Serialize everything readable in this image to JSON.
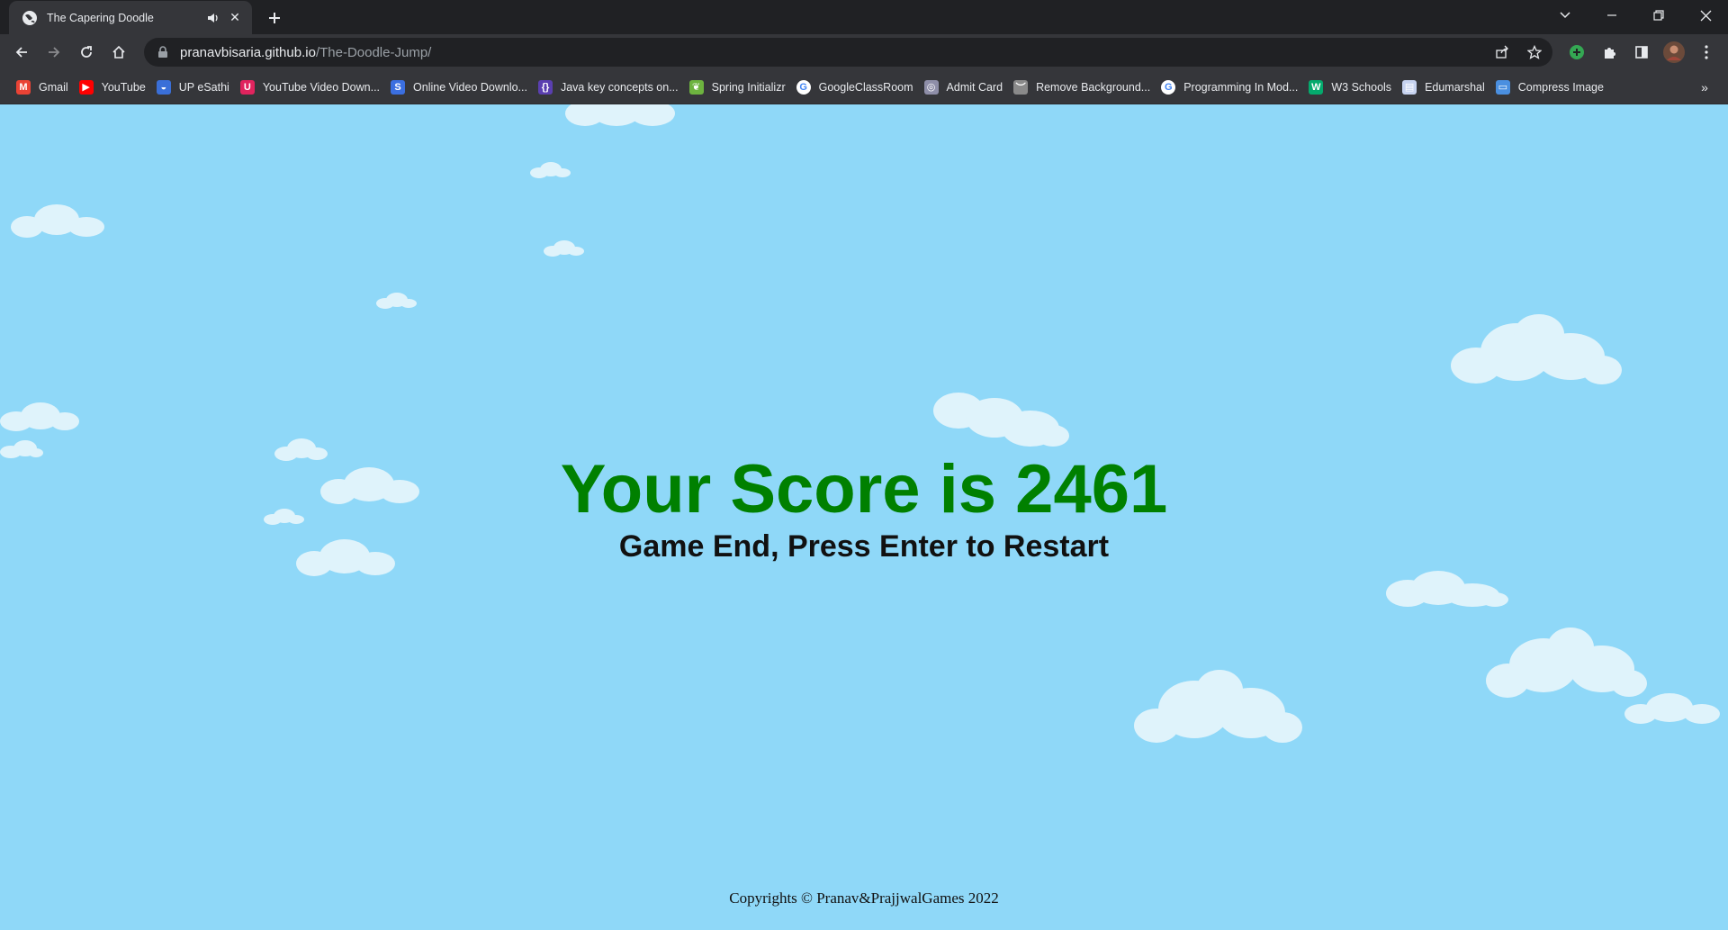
{
  "browser": {
    "tab": {
      "title": "The Capering Doodle",
      "audio_icon": "speaker-icon",
      "close_label": "✕"
    },
    "new_tab_label": "+",
    "address_bar": {
      "domain": "pranavbisaria.github.io",
      "path": "/The-Doodle-Jump/"
    },
    "bookmarks": [
      {
        "label": "Gmail",
        "icon": "gmail-icon",
        "color": "#ea4335",
        "glyph": "M"
      },
      {
        "label": "YouTube",
        "icon": "youtube-icon",
        "color": "#ff0000",
        "glyph": "▶"
      },
      {
        "label": "UP eSathi",
        "icon": "upesathi-icon",
        "color": "#3a6fd8",
        "glyph": "◒"
      },
      {
        "label": "YouTube Video Down...",
        "icon": "download-icon",
        "color": "#e0245e",
        "glyph": "U"
      },
      {
        "label": "Online Video Downlo...",
        "icon": "s-icon",
        "color": "#3b6fe0",
        "glyph": "S"
      },
      {
        "label": "Java key concepts on...",
        "icon": "java-icon",
        "color": "#5a3fb0",
        "glyph": "{}"
      },
      {
        "label": "Spring Initializr",
        "icon": "spring-icon",
        "color": "#6db33f",
        "glyph": "❦"
      },
      {
        "label": "GoogleClassRoom",
        "icon": "google-icon",
        "color": "#ffffff",
        "glyph": "G"
      },
      {
        "label": "Admit Card",
        "icon": "admit-card-icon",
        "color": "#8e8ea8",
        "glyph": "◎"
      },
      {
        "label": "Remove Background...",
        "icon": "remove-bg-icon",
        "color": "#8a8a8a",
        "glyph": "︶"
      },
      {
        "label": "Programming In Mod...",
        "icon": "google-icon",
        "color": "#ffffff",
        "glyph": "G"
      },
      {
        "label": "W3 Schools",
        "icon": "w3schools-icon",
        "color": "#04aa6d",
        "glyph": "W"
      },
      {
        "label": "Edumarshal",
        "icon": "page-icon",
        "color": "#c7d3f0",
        "glyph": "▤"
      },
      {
        "label": "Compress Image",
        "icon": "image-icon",
        "color": "#4a8fe0",
        "glyph": "▭"
      }
    ],
    "bookmarks_more": "»"
  },
  "game": {
    "score_text": "Your Score is 2461",
    "restart_text": "Game End, Press Enter to Restart",
    "copyright": "Copyrights © Pranav&PrajjwalGames 2022",
    "sky_color": "#8fd8f8",
    "score_color": "#008000"
  }
}
